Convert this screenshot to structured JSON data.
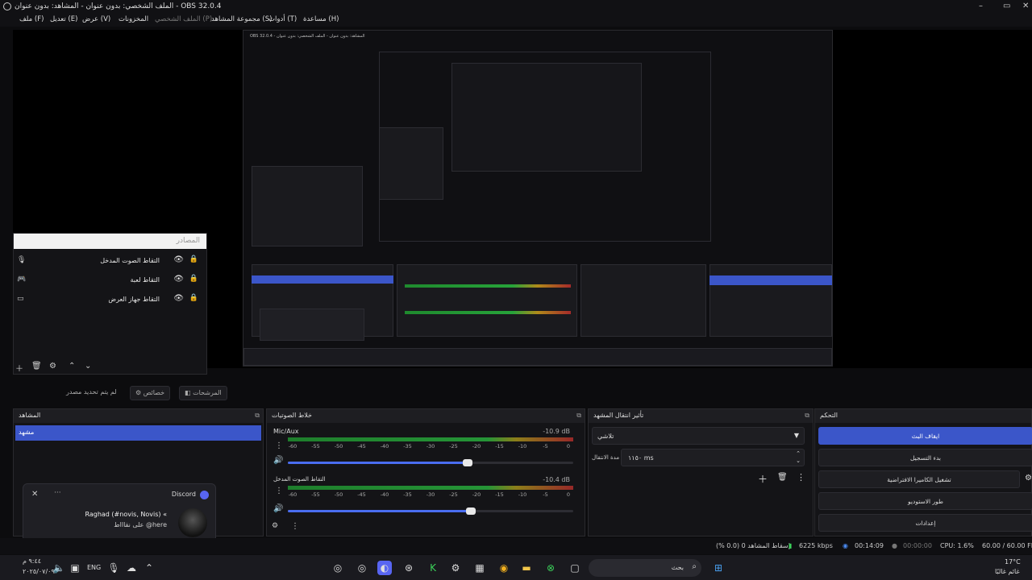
{
  "window": {
    "title": "الملف الشخصي: بدون عنوان - المشاهد: بدون عنوان - OBS 32.0.4"
  },
  "menu": {
    "file": "ملف (F)",
    "edit": "تعديل (E)",
    "view": "عرض (V)",
    "docks": "المخزونات",
    "profile": "الملف الشخصي (P)",
    "scene_collection": "مجموعة المشاهد (S)",
    "tools": "أدوات (T)",
    "help": "مساعدة (H)"
  },
  "sources": {
    "header": "المصادر",
    "items": [
      {
        "label": "التقاط الصوت المدخل",
        "icon": "mic-icon"
      },
      {
        "label": "التقاط لعبة",
        "icon": "gamepad-icon"
      },
      {
        "label": "التقاط جهاز العرض",
        "icon": "monitor-icon"
      }
    ]
  },
  "toolbar": {
    "no_source": "لم يتم تحديد مصدر",
    "properties": "خصائص",
    "filters": "المرشحات"
  },
  "scenes": {
    "header": "المشاهد",
    "items": [
      "مشهد"
    ]
  },
  "mixer": {
    "header": "خلاط الصوتيات",
    "ticks": [
      "-60",
      "-55",
      "-50",
      "-45",
      "-40",
      "-35",
      "-30",
      "-25",
      "-20",
      "-15",
      "-10",
      "-5",
      "0"
    ],
    "channels": [
      {
        "name": "Mic/Aux",
        "db": "-10.9 dB",
        "volume": 0.63
      },
      {
        "name": "التقاط الصوت المدخل",
        "db": "-10.4 dB",
        "volume": 0.64
      }
    ]
  },
  "transitions": {
    "header": "تأثير انتقال المشهد",
    "selected": "تلاشي",
    "duration_label": "مدة الانتقال",
    "duration_value": "١١٥٠ ms"
  },
  "controls": {
    "header": "التحكم",
    "buttons": [
      "ايقاف البث",
      "بدء التسجيل",
      "تشغيل الكاميرا الافتراضية",
      "طور الاستوديو",
      "إعدادات"
    ]
  },
  "notification": {
    "app": "Discord",
    "sender": "Raghad (#novis, Novis) «",
    "message": "على نقاااط @here"
  },
  "status": {
    "dropped": "إسقاط المشاهد 0 (0.0 %)",
    "bitrate": "6225 kbps",
    "stream_time": "00:14:09",
    "rec_time": "00:00:00",
    "cpu": "CPU: 1.6%",
    "fps": "60.00 / 60.00 FPS"
  },
  "taskbar": {
    "clock_time": "٩:٤٤ م",
    "clock_date": "٢٠٢٥/٠٧/٠٩",
    "lang": "ENG",
    "search_placeholder": "بحث",
    "weather_temp": "17°C",
    "weather_desc": "غائم غالبًا"
  },
  "preview_nested": {
    "title": "OBS 32.0.4 - المشاهد: بدون عنوان - الملف الشخصي: بدون عنوان"
  }
}
